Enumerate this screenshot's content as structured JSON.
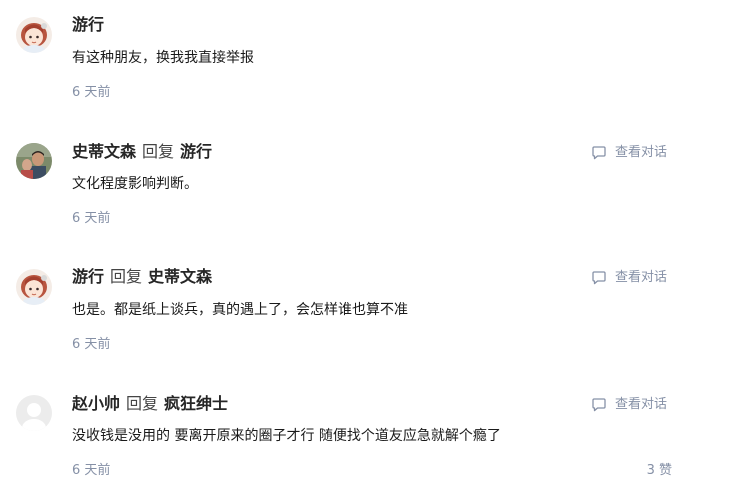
{
  "comments": [
    {
      "author": "游行",
      "content": "有这种朋友，换我我直接举报",
      "time": "6 天前",
      "avatar": "anime-girl-avatar"
    },
    {
      "author": "史蒂文森",
      "reply_word": "回复",
      "reply_to": "游行",
      "content": "文化程度影响判断。",
      "time": "6 天前",
      "view_conversation": "查看对话",
      "avatar": "photo-avatar"
    },
    {
      "author": "游行",
      "reply_word": "回复",
      "reply_to": "史蒂文森",
      "content": "也是。都是纸上谈兵，真的遇上了，会怎样谁也算不准",
      "time": "6 天前",
      "view_conversation": "查看对话",
      "avatar": "anime-girl-avatar"
    },
    {
      "author": "赵小帅",
      "reply_word": "回复",
      "reply_to": "疯狂绅士",
      "content": "没收钱是没用的 要离开原来的圈子才行 随便找个道友应急就解个瘾了",
      "time": "6 天前",
      "view_conversation": "查看对话",
      "likes": "3 赞",
      "avatar": "default-user-avatar"
    }
  ],
  "colors": {
    "meta": "#8590a6",
    "text": "#262626"
  }
}
